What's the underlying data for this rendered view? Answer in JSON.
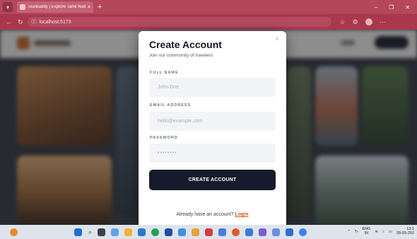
{
  "browser": {
    "tab_title": "TourBuddy | Explore Tamil Nadu",
    "tab_close": "×",
    "new_tab": "+",
    "url": "localhost:5173",
    "window_controls": {
      "minimize": "–",
      "restore": "❐",
      "close": "✕"
    }
  },
  "modal": {
    "title": "Create Account",
    "subtitle": "Join our community of travelers",
    "close_icon": "×",
    "fields": [
      {
        "label": "FULL NAME",
        "placeholder": "John Doe"
      },
      {
        "label": "EMAIL ADDRESS",
        "placeholder": "hello@example.com"
      },
      {
        "label": "PASSWORD",
        "placeholder": "••••••••"
      }
    ],
    "submit_label": "CREATE ACCOUNT",
    "footer_text": "Already have an account?",
    "footer_link": "Login"
  },
  "taskbar": {
    "lang_top": "ENG",
    "lang_bottom": "IN",
    "time": "13:1",
    "date": "28-03-202"
  },
  "colors": {
    "browser_accent": "#b5475c",
    "cta_background": "#161b2b",
    "link_accent": "#c85a12"
  }
}
